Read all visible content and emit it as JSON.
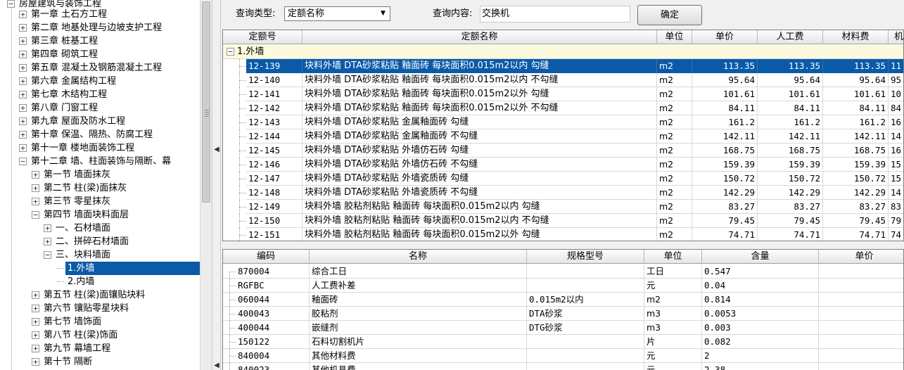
{
  "tree": {
    "root": "房屋建筑与装饰工程",
    "items": [
      {
        "label": "第一章  土石方工程",
        "level": 1,
        "toggle": "plus"
      },
      {
        "label": "第二章  地基处理与边坡支护工程",
        "level": 1,
        "toggle": "plus"
      },
      {
        "label": "第三章  桩基工程",
        "level": 1,
        "toggle": "plus"
      },
      {
        "label": "第四章  砌筑工程",
        "level": 1,
        "toggle": "plus"
      },
      {
        "label": "第五章  混凝土及钢筋混凝土工程",
        "level": 1,
        "toggle": "plus"
      },
      {
        "label": "第六章  金属结构工程",
        "level": 1,
        "toggle": "plus"
      },
      {
        "label": "第七章  木结构工程",
        "level": 1,
        "toggle": "plus"
      },
      {
        "label": "第八章  门窗工程",
        "level": 1,
        "toggle": "plus"
      },
      {
        "label": "第九章  屋面及防水工程",
        "level": 1,
        "toggle": "plus"
      },
      {
        "label": "第十章  保温、隔热、防腐工程",
        "level": 1,
        "toggle": "plus"
      },
      {
        "label": "第十一章  楼地面装饰工程",
        "level": 1,
        "toggle": "plus"
      },
      {
        "label": "第十二章  墙、柱面装饰与隔断、幕",
        "level": 1,
        "toggle": "minus"
      },
      {
        "label": "第一节  墙面抹灰",
        "level": 2,
        "toggle": "plus"
      },
      {
        "label": "第二节  柱(梁)面抹灰",
        "level": 2,
        "toggle": "plus"
      },
      {
        "label": "第三节  零星抹灰",
        "level": 2,
        "toggle": "plus"
      },
      {
        "label": "第四节  墙面块料面层",
        "level": 2,
        "toggle": "minus"
      },
      {
        "label": "一、石材墙面",
        "level": 3,
        "toggle": "plus"
      },
      {
        "label": "二、拼碎石材墙面",
        "level": 3,
        "toggle": "plus"
      },
      {
        "label": "三、块料墙面",
        "level": 3,
        "toggle": "minus"
      },
      {
        "label": "1.外墙",
        "level": 4,
        "toggle": "none",
        "selected": true
      },
      {
        "label": "2.内墙",
        "level": 4,
        "toggle": "none"
      },
      {
        "label": "第五节  柱(梁)面镶贴块料",
        "level": 2,
        "toggle": "plus"
      },
      {
        "label": "第六节  镶贴零星块料",
        "level": 2,
        "toggle": "plus"
      },
      {
        "label": "第七节  墙饰面",
        "level": 2,
        "toggle": "plus"
      },
      {
        "label": "第八节  柱(梁)饰面",
        "level": 2,
        "toggle": "plus"
      },
      {
        "label": "第九节  幕墙工程",
        "level": 2,
        "toggle": "plus"
      },
      {
        "label": "第十节  隔断",
        "level": 2,
        "toggle": "plus"
      }
    ]
  },
  "query": {
    "type_label": "查询类型:",
    "type_value": "定额名称",
    "content_label": "查询内容:",
    "content_value": "交换机",
    "confirm_label": "确定"
  },
  "quota_table": {
    "columns": [
      "定额号",
      "定额名称",
      "单位",
      "单价",
      "人工费",
      "材料费",
      "机"
    ],
    "group": "1.外墙",
    "rows": [
      [
        "12-139",
        "块料外墙 DTA砂浆粘贴 釉面砖 每块面积0.015m2以内 勾缝",
        "m2",
        "113.35",
        "113.35",
        "113.35",
        "11"
      ],
      [
        "12-140",
        "块料外墙 DTA砂浆粘贴 釉面砖 每块面积0.015m2以内 不勾缝",
        "m2",
        "95.64",
        "95.64",
        "95.64",
        "95"
      ],
      [
        "12-141",
        "块料外墙 DTA砂浆粘贴 釉面砖 每块面积0.015m2以外 勾缝",
        "m2",
        "101.61",
        "101.61",
        "101.61",
        "10"
      ],
      [
        "12-142",
        "块料外墙 DTA砂浆粘贴 釉面砖 每块面积0.015m2以外 不勾缝",
        "m2",
        "84.11",
        "84.11",
        "84.11",
        "84"
      ],
      [
        "12-143",
        "块料外墙 DTA砂浆粘贴 金属釉面砖 勾缝",
        "m2",
        "161.2",
        "161.2",
        "161.2",
        "16"
      ],
      [
        "12-144",
        "块料外墙 DTA砂浆粘贴 金属釉面砖 不勾缝",
        "m2",
        "142.11",
        "142.11",
        "142.11",
        "14"
      ],
      [
        "12-145",
        "块料外墙 DTA砂浆粘贴 外墙仿石砖 勾缝",
        "m2",
        "168.75",
        "168.75",
        "168.75",
        "16"
      ],
      [
        "12-146",
        "块料外墙 DTA砂浆粘贴 外墙仿石砖 不勾缝",
        "m2",
        "159.39",
        "159.39",
        "159.39",
        "15"
      ],
      [
        "12-147",
        "块料外墙 DTA砂浆粘贴 外墙瓷质砖 勾缝",
        "m2",
        "150.72",
        "150.72",
        "150.72",
        "15"
      ],
      [
        "12-148",
        "块料外墙 DTA砂浆粘贴 外墙瓷质砖 不勾缝",
        "m2",
        "142.29",
        "142.29",
        "142.29",
        "14"
      ],
      [
        "12-149",
        "块料外墙 胶粘剂粘贴 釉面砖 每块面积0.015m2以内 勾缝",
        "m2",
        "83.27",
        "83.27",
        "83.27",
        "83"
      ],
      [
        "12-150",
        "块料外墙 胶粘剂粘贴 釉面砖 每块面积0.015m2以内 不勾缝",
        "m2",
        "79.45",
        "79.45",
        "79.45",
        "79"
      ],
      [
        "12-151",
        "块料外墙 胶粘剂粘贴 釉面砖 每块面积0.015m2以外 勾缝",
        "m2",
        "74.71",
        "74.71",
        "74.71",
        "74"
      ]
    ],
    "selected_row": 0
  },
  "material_table": {
    "columns": [
      "编码",
      "名称",
      "规格型号",
      "单位",
      "含量",
      "单价"
    ],
    "rows": [
      [
        "870004",
        "综合工日",
        "",
        "工日",
        "0.547",
        ""
      ],
      [
        "RGFBC",
        "人工费补差",
        "",
        "元",
        "0.04",
        ""
      ],
      [
        "060044",
        "釉面砖",
        "0.015m2以内",
        "m2",
        "0.814",
        ""
      ],
      [
        "400043",
        "胶粘剂",
        "DTA砂浆",
        "m3",
        "0.0053",
        ""
      ],
      [
        "400044",
        "嵌缝剂",
        "DTG砂浆",
        "m3",
        "0.003",
        ""
      ],
      [
        "150122",
        "石料切割机片",
        "",
        "片",
        "0.082",
        ""
      ],
      [
        "840004",
        "其他材料费",
        "",
        "元",
        "2",
        ""
      ],
      [
        "840023",
        "其他机具费",
        "",
        "元",
        "2.38",
        ""
      ]
    ]
  },
  "colors": {
    "selection": "#0a5aa8",
    "group_row": "#fcf9dc"
  }
}
